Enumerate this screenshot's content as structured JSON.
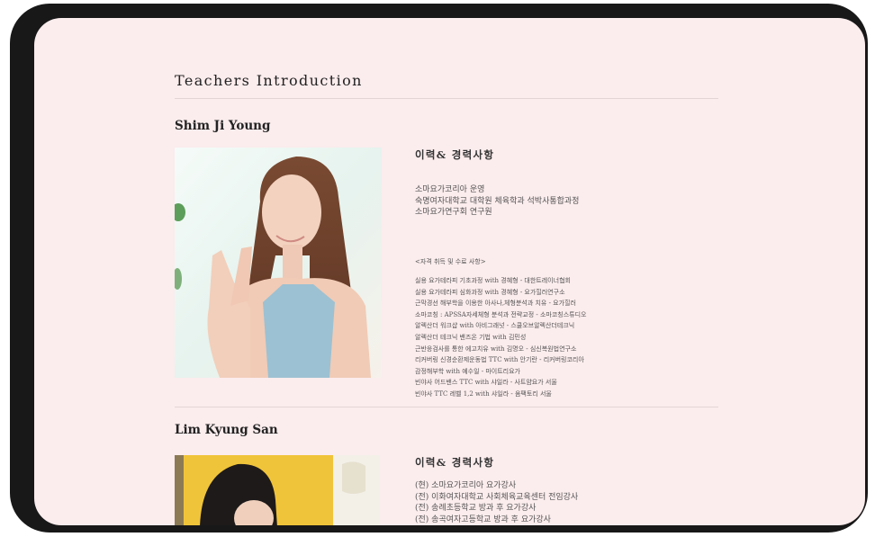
{
  "page": {
    "title": "Teachers Introduction"
  },
  "teachers": [
    {
      "name": "Shim Ji Young",
      "heading": "이력& 경력사항",
      "career": [
        "소마요가코리아 운영",
        "숙명여자대학교 대학원 체육학과 석박사통합과정",
        "소마요가연구회 연구원"
      ],
      "certificates_title": "<자격 취득 및 수료 사항>",
      "certificates": [
        "실용 요가테라피 기초과정 with 경혜형 - 대한트레이너협회",
        "실용 요가테라피 심화과정 with 경혜형 - 요가힐러연구소",
        "근막경선 해부학을 이용한 아사나,체형분석과 치유 - 요가힐러",
        "소마코칭 : APSSA자세체형 분석과 전략교정 - 소마코칭스튜디오",
        "알렉산더 워크샵 with 아비그래넛 - 스쿨오브알렉산더테크닉",
        "알렉산더 테크닉 밴즈온 기법 with 김민성",
        "근반응검사를 통한 에고치유 with 김명오 - 심신복원법연구소",
        "리커버링 신경순환제운동법 TTC with 안기란 - 리커버링코리아",
        "감정해부학 with 예수일 - 마이트리요가",
        "빈야사 어드밴스 TTC with 샤일라 - 사트얌요가 서울",
        "빈야사 TTC 레벨 1,2 with 샤일라 - 옴팩토리 서울"
      ]
    },
    {
      "name": "Lim Kyung San",
      "heading": "이력& 경력사항",
      "career": [
        "(현) 소마요가코리아 요가강사",
        "(전) 이화여자대학교 사회체육교육센터 전임강사",
        "(전) 송례초등학교 방과 후 요가강사",
        "(전) 송곡여자고등학교 방과 후 요가강사"
      ]
    }
  ]
}
